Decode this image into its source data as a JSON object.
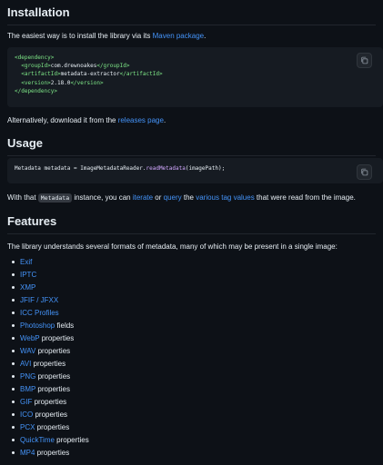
{
  "sections": {
    "installation": {
      "title": "Installation",
      "intro_pre": "The easiest way is to install the library via its ",
      "intro_link": "Maven package",
      "intro_post": ".",
      "code_lines": [
        {
          "open": "<dependency>",
          "text": "",
          "close": ""
        },
        {
          "open": "  <groupId>",
          "text": "com.drewnoakes",
          "close": "</groupId>"
        },
        {
          "open": "  <artifactId>",
          "text": "metadata-extractor",
          "close": "</artifactId>"
        },
        {
          "open": "  <version>",
          "text": "2.18.0",
          "close": "</version>"
        },
        {
          "open": "</dependency>",
          "text": "",
          "close": ""
        }
      ],
      "after_pre": "Alternatively, download it from the ",
      "after_link": "releases page",
      "after_post": "."
    },
    "usage": {
      "title": "Usage",
      "code_prefix": "Metadata metadata = ImageMetadataReader.",
      "code_fn": "readMetadata",
      "code_suffix": "(imagePath);",
      "text_pre": "With that ",
      "inline_code": "Metadata",
      "text_mid1": " instance, you can ",
      "link_iterate": "iterate",
      "text_or": " or ",
      "link_query": "query",
      "text_the": " the ",
      "link_tags": "various tag values",
      "text_post": " that were read from the image."
    },
    "features": {
      "title": "Features",
      "intro": "The library understands several formats of metadata, many of which may be present in a single image:",
      "items": [
        {
          "link": "Exif",
          "suffix": ""
        },
        {
          "link": "IPTC",
          "suffix": ""
        },
        {
          "link": "XMP",
          "suffix": ""
        },
        {
          "link": "JFIF / JFXX",
          "suffix": ""
        },
        {
          "link": "ICC Profiles",
          "suffix": ""
        },
        {
          "link": "Photoshop",
          "suffix": " fields"
        },
        {
          "link": "WebP",
          "suffix": " properties"
        },
        {
          "link": "WAV",
          "suffix": " properties"
        },
        {
          "link": "AVI",
          "suffix": " properties"
        },
        {
          "link": "PNG",
          "suffix": " properties"
        },
        {
          "link": "BMP",
          "suffix": " properties"
        },
        {
          "link": "GIF",
          "suffix": " properties"
        },
        {
          "link": "ICO",
          "suffix": " properties"
        },
        {
          "link": "PCX",
          "suffix": " properties"
        },
        {
          "link": "QuickTime",
          "suffix": " properties"
        },
        {
          "link": "MP4",
          "suffix": " properties"
        }
      ]
    }
  },
  "icons": {
    "copy": "copy-icon"
  },
  "colors": {
    "background": "#0d1117",
    "code_bg": "#161b22",
    "link": "#4493f8",
    "tag": "#7ee787",
    "function": "#d2a8ff"
  }
}
